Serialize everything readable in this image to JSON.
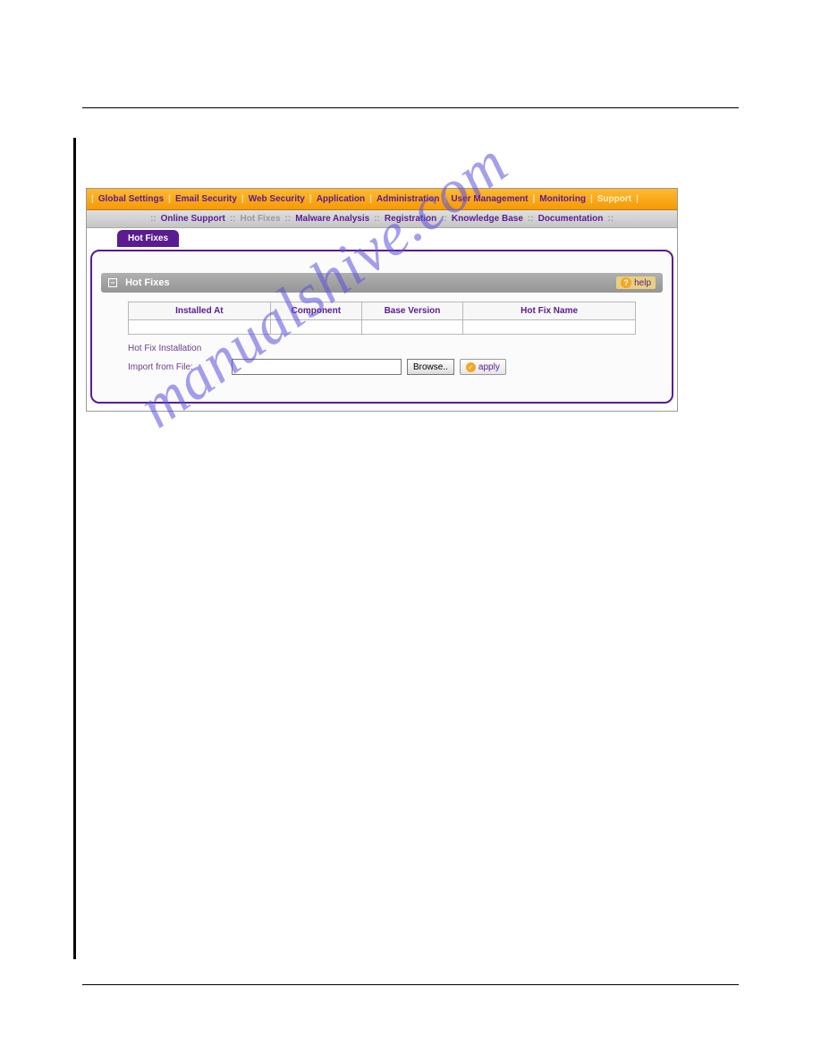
{
  "watermark": "manualshive.com",
  "topNav": {
    "items": [
      "Global Settings",
      "Email Security",
      "Web Security",
      "Application",
      "Administration",
      "User Management",
      "Monitoring"
    ],
    "support": "Support"
  },
  "subNav": {
    "items": [
      "Online Support",
      "Hot Fixes",
      "Malware Analysis",
      "Registration",
      "Knowledge Base",
      "Documentation"
    ],
    "activeIndex": 1
  },
  "tab": {
    "label": "Hot Fixes"
  },
  "panel": {
    "title": "Hot Fixes",
    "helpLabel": "help",
    "columns": [
      "Installed At",
      "Component",
      "Base Version",
      "Hot Fix Name"
    ],
    "rows": [
      [
        "",
        "",
        "",
        ""
      ]
    ],
    "installTitle": "Hot Fix Installation",
    "importLabel": "Import from File:",
    "fileValue": "",
    "browseLabel": "Browse..",
    "applyLabel": "apply"
  }
}
